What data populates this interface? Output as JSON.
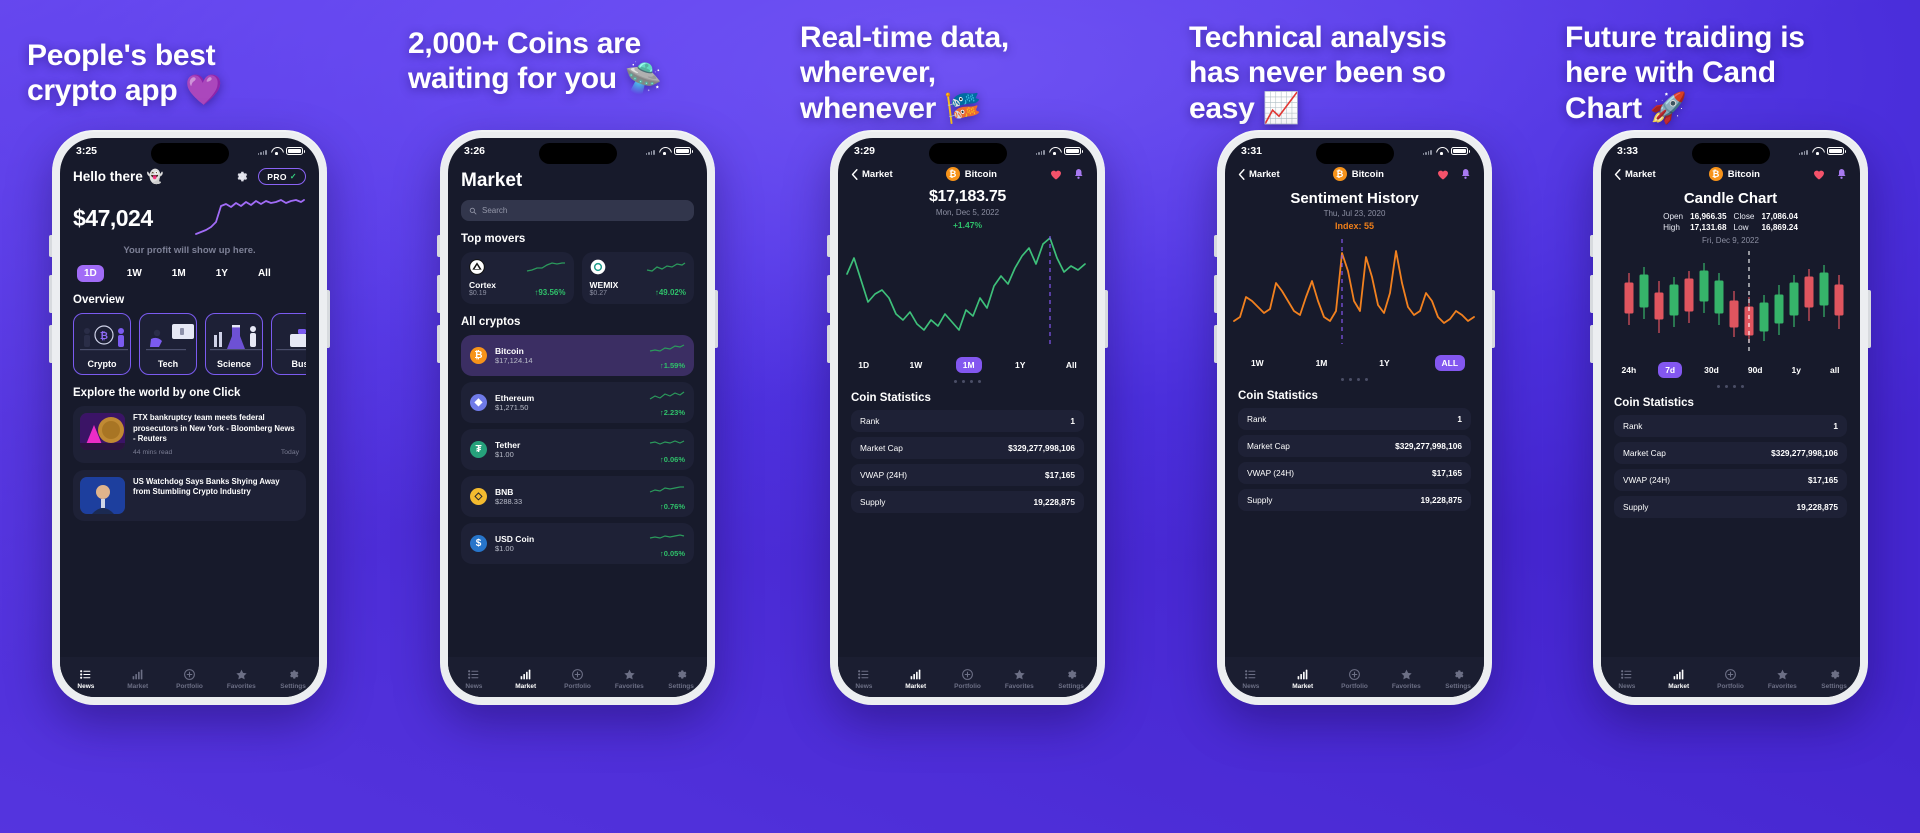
{
  "theme": {
    "bg_purple": "#4b2fdc",
    "accent_purple": "#8357f0",
    "screen_bg": "#171A2B",
    "card_bg": "#1e2136",
    "green": "#2fc06a",
    "orange": "#ef7f1a",
    "btc_orange": "#f7931a",
    "red_heart": "#f4526a"
  },
  "panels": [
    {
      "headline": "People's best\ncrypto app 💜",
      "phone": {
        "status": {
          "time": "3:25"
        },
        "screen": "home",
        "greeting": "Hello there 👻",
        "pro_badge": {
          "label": "PRO",
          "check": "✓"
        },
        "balance": "$47,024",
        "profit_note": "Your profit will show up here.",
        "ranges": [
          "1D",
          "1W",
          "1M",
          "1Y",
          "All"
        ],
        "range_active": "1D",
        "overview_title": "Overview",
        "categories": [
          "Crypto",
          "Tech",
          "Science",
          "Bus"
        ],
        "explore_title": "Explore the world by one Click",
        "news": [
          {
            "title": "FTX bankruptcy team meets federal prosecutors in New York - Bloomberg News - Reuters",
            "read": "44 mins read",
            "when": "Today"
          },
          {
            "title": "US Watchdog Says Banks Shying Away from Stumbling Crypto Industry",
            "read": "",
            "when": ""
          }
        ],
        "tabs": [
          "News",
          "Market",
          "Portfolio",
          "Favorites",
          "Settings"
        ],
        "tab_active": "News"
      }
    },
    {
      "headline": "2,000+ Coins are\nwaiting for you 🛸",
      "phone": {
        "status": {
          "time": "3:26"
        },
        "screen": "market",
        "title": "Market",
        "search_placeholder": "Search",
        "top_movers_title": "Top movers",
        "movers": [
          {
            "name": "Cortex",
            "price": "$0.19",
            "change": "93.56%",
            "arrow": "↑"
          },
          {
            "name": "WEMIX",
            "price": "$0.27",
            "change": "49.02%",
            "arrow": "↑"
          }
        ],
        "all_cryptos_title": "All cryptos",
        "coins": [
          {
            "name": "Bitcoin",
            "price": "$17,124.14",
            "change": "1.59%",
            "arrow": "↑",
            "symbol": "₿",
            "color": "#f7931a",
            "selected": true
          },
          {
            "name": "Ethereum",
            "price": "$1,271.50",
            "change": "2.23%",
            "arrow": "↑",
            "symbol": "◆",
            "color": "#6f7ae8",
            "selected": false
          },
          {
            "name": "Tether",
            "price": "$1.00",
            "change": "0.06%",
            "arrow": "↑",
            "symbol": "₮",
            "color": "#26a17b",
            "selected": false
          },
          {
            "name": "BNB",
            "price": "$288.33",
            "change": "0.76%",
            "arrow": "↑",
            "symbol": "◇",
            "color": "#f3ba2f",
            "selected": false
          },
          {
            "name": "USD Coin",
            "price": "$1.00",
            "change": "0.05%",
            "arrow": "↑",
            "symbol": "$",
            "color": "#2775ca",
            "selected": false
          }
        ],
        "tabs": [
          "News",
          "Market",
          "Portfolio",
          "Favorites",
          "Settings"
        ],
        "tab_active": "Market"
      }
    },
    {
      "headline": "Real-time data,\nwherever,\nwhenever 🎏",
      "phone": {
        "status": {
          "time": "3:29"
        },
        "screen": "detail-line",
        "back_label": "Market",
        "coin_name": "Bitcoin",
        "price": "$17,183.75",
        "date": "Mon, Dec 5, 2022",
        "change": "+1.47%",
        "ranges": [
          "1D",
          "1W",
          "1M",
          "1Y",
          "All"
        ],
        "range_active": "1M",
        "stats_title": "Coin Statistics",
        "stats": [
          {
            "label": "Rank",
            "value": "1"
          },
          {
            "label": "Market Cap",
            "value": "$329,277,998,106"
          },
          {
            "label": "VWAP (24H)",
            "value": "$17,165"
          },
          {
            "label": "Supply",
            "value": "19,228,875"
          }
        ],
        "tabs": [
          "News",
          "Market",
          "Portfolio",
          "Favorites",
          "Settings"
        ],
        "tab_active": "Market"
      }
    },
    {
      "headline": "Technical analysis\nhas never been so\neasy 📈",
      "phone": {
        "status": {
          "time": "3:31"
        },
        "screen": "sentiment",
        "back_label": "Market",
        "coin_name": "Bitcoin",
        "title": "Sentiment History",
        "date": "Thu, Jul 23, 2020",
        "index": "Index: 55",
        "ranges": [
          "1W",
          "1M",
          "1Y",
          "ALL"
        ],
        "range_active": "ALL",
        "stats_title": "Coin Statistics",
        "stats": [
          {
            "label": "Rank",
            "value": "1"
          },
          {
            "label": "Market Cap",
            "value": "$329,277,998,106"
          },
          {
            "label": "VWAP (24H)",
            "value": "$17,165"
          },
          {
            "label": "Supply",
            "value": "19,228,875"
          }
        ],
        "tabs": [
          "News",
          "Market",
          "Portfolio",
          "Favorites",
          "Settings"
        ],
        "tab_active": "Market"
      }
    },
    {
      "headline": "Future traiding is\nhere with Cand\nChart 🚀",
      "phone": {
        "status": {
          "time": "3:33"
        },
        "screen": "candle",
        "back_label": "Market",
        "coin_name": "Bitcoin",
        "title": "Candle Chart",
        "ohlc": [
          {
            "k": "Open",
            "v": "16,966.35"
          },
          {
            "k": "Close",
            "v": "17,086.04"
          },
          {
            "k": "High",
            "v": "17,131.68"
          },
          {
            "k": "Low",
            "v": "16,869.24"
          }
        ],
        "date": "Fri, Dec 9, 2022",
        "ranges": [
          "24h",
          "7d",
          "30d",
          "90d",
          "1y",
          "all"
        ],
        "range_active": "7d",
        "stats_title": "Coin Statistics",
        "stats": [
          {
            "label": "Rank",
            "value": "1"
          },
          {
            "label": "Market Cap",
            "value": "$329,277,998,106"
          },
          {
            "label": "VWAP (24H)",
            "value": "$17,165"
          },
          {
            "label": "Supply",
            "value": "19,228,875"
          }
        ],
        "tabs": [
          "News",
          "Market",
          "Portfolio",
          "Favorites",
          "Settings"
        ],
        "tab_active": "Market"
      }
    }
  ],
  "chart_data": [
    {
      "type": "line",
      "title": "Portfolio balance sparkline",
      "series": [
        {
          "name": "balance",
          "values": [
            2,
            4,
            6,
            9,
            14,
            42,
            46,
            44,
            48,
            45,
            50,
            47,
            52,
            49,
            54,
            51,
            53,
            56,
            52,
            55,
            58,
            54,
            57,
            60,
            56,
            59,
            62,
            58,
            61,
            57,
            60,
            63
          ]
        }
      ],
      "color": "#a16cf7",
      "ylim": [
        0,
        70
      ],
      "grid": false
    },
    {
      "type": "line",
      "title": "Bitcoin price 1M",
      "series": [
        {
          "name": "price",
          "values": [
            62,
            72,
            58,
            40,
            46,
            50,
            44,
            30,
            26,
            32,
            22,
            18,
            24,
            20,
            28,
            22,
            18,
            30,
            26,
            36,
            30,
            44,
            52,
            46,
            58,
            66,
            72,
            62,
            78,
            86,
            70,
            62,
            66
          ]
        }
      ],
      "color": "#3ec07a",
      "ylim": [
        0,
        100
      ],
      "grid": false,
      "annotation": "cursor dashed line near right"
    },
    {
      "type": "line",
      "title": "Sentiment History ALL",
      "series": [
        {
          "name": "index",
          "values": [
            20,
            24,
            44,
            40,
            34,
            28,
            32,
            58,
            50,
            40,
            30,
            26,
            44,
            60,
            40,
            24,
            20,
            30,
            88,
            70,
            40,
            30,
            84,
            64,
            36,
            28,
            48,
            90,
            58,
            34,
            26,
            30,
            48,
            40,
            24,
            18,
            22,
            30,
            26
          ]
        }
      ],
      "color": "#f2811f",
      "ylim": [
        0,
        100
      ],
      "grid": false,
      "annotation": "dashed vertical marker at index 55"
    },
    {
      "type": "candlestick",
      "title": "Candle Chart 7d",
      "ohlc_summary": {
        "open": 16966.35,
        "close": 17086.04,
        "high": 17131.68,
        "low": 16869.24
      },
      "candles": [
        {
          "o": 34,
          "c": 48,
          "h": 54,
          "l": 28,
          "dir": "up"
        },
        {
          "o": 48,
          "c": 40,
          "h": 56,
          "l": 34,
          "dir": "down"
        },
        {
          "o": 40,
          "c": 52,
          "h": 58,
          "l": 36,
          "dir": "up"
        },
        {
          "o": 52,
          "c": 44,
          "h": 62,
          "l": 40,
          "dir": "down"
        },
        {
          "o": 44,
          "c": 58,
          "h": 66,
          "l": 40,
          "dir": "up"
        },
        {
          "o": 58,
          "c": 50,
          "h": 70,
          "l": 46,
          "dir": "down"
        },
        {
          "o": 50,
          "c": 64,
          "h": 72,
          "l": 46,
          "dir": "up"
        },
        {
          "o": 64,
          "c": 56,
          "h": 74,
          "l": 52,
          "dir": "down"
        },
        {
          "o": 56,
          "c": 42,
          "h": 62,
          "l": 36,
          "dir": "down"
        },
        {
          "o": 42,
          "c": 34,
          "h": 50,
          "l": 28,
          "dir": "down"
        },
        {
          "o": 34,
          "c": 46,
          "h": 54,
          "l": 30,
          "dir": "up"
        },
        {
          "o": 46,
          "c": 60,
          "h": 68,
          "l": 42,
          "dir": "up"
        },
        {
          "o": 60,
          "c": 52,
          "h": 70,
          "l": 48,
          "dir": "down"
        },
        {
          "o": 52,
          "c": 66,
          "h": 76,
          "l": 48,
          "dir": "up"
        }
      ],
      "colors": {
        "up": "#36b36a",
        "down": "#e0555f"
      }
    }
  ]
}
